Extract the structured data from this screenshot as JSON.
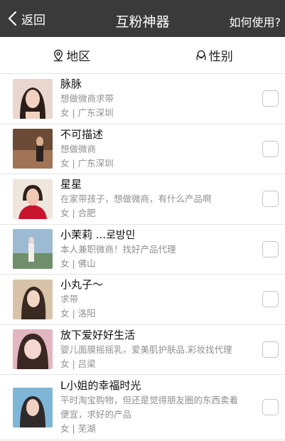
{
  "nav": {
    "back_label": "返回",
    "title": "互粉神器",
    "help_label": "如何使用?"
  },
  "filters": {
    "region": "地区",
    "gender": "性别"
  },
  "users": [
    {
      "name": "脉脉",
      "desc": "想做微商求带",
      "location": "女 | 广东深圳",
      "avatar_colors": [
        "#e8d6cf",
        "#2b1d1a",
        "#f1d2bf"
      ]
    },
    {
      "name": "不可描述",
      "desc": "想做微商",
      "location": "女 | 广东深圳",
      "avatar_colors": [
        "#6b4a36",
        "#a07455",
        "#d7b08e"
      ]
    },
    {
      "name": "星星",
      "desc": "在家带孩子，想做微商，有什么产品啊",
      "location": "女 | 合肥",
      "avatar_colors": [
        "#efe6de",
        "#c9152c",
        "#f0c8b3"
      ]
    },
    {
      "name": "小茉莉 ...로방민",
      "desc": "本人兼职微商！找好产品代理",
      "location": "女 | 佛山",
      "avatar_colors": [
        "#9dbad3",
        "#6f8f6a",
        "#e7d7cc"
      ]
    },
    {
      "name": "小丸子～",
      "desc": "求带",
      "location": "女 | 洛阳",
      "avatar_colors": [
        "#d9c3a8",
        "#3a2a22",
        "#f2d6c5"
      ]
    },
    {
      "name": "放下爱好好生活",
      "desc": "婴儿面膜摇摇乳，爱美肌护肤品.彩妆找代理",
      "location": "女 | 吕梁",
      "avatar_colors": [
        "#e2b6c0",
        "#3b2822",
        "#f4d7cf"
      ]
    },
    {
      "name": "L小姐的幸福时光",
      "desc": "平时淘宝购物，但还是觉得朋友圈的东西卖着便宜，求好的产品",
      "location": "女 | 芜湖",
      "avatar_colors": [
        "#7fb6d8",
        "#2f2a2a",
        "#f1d1c2"
      ]
    }
  ]
}
